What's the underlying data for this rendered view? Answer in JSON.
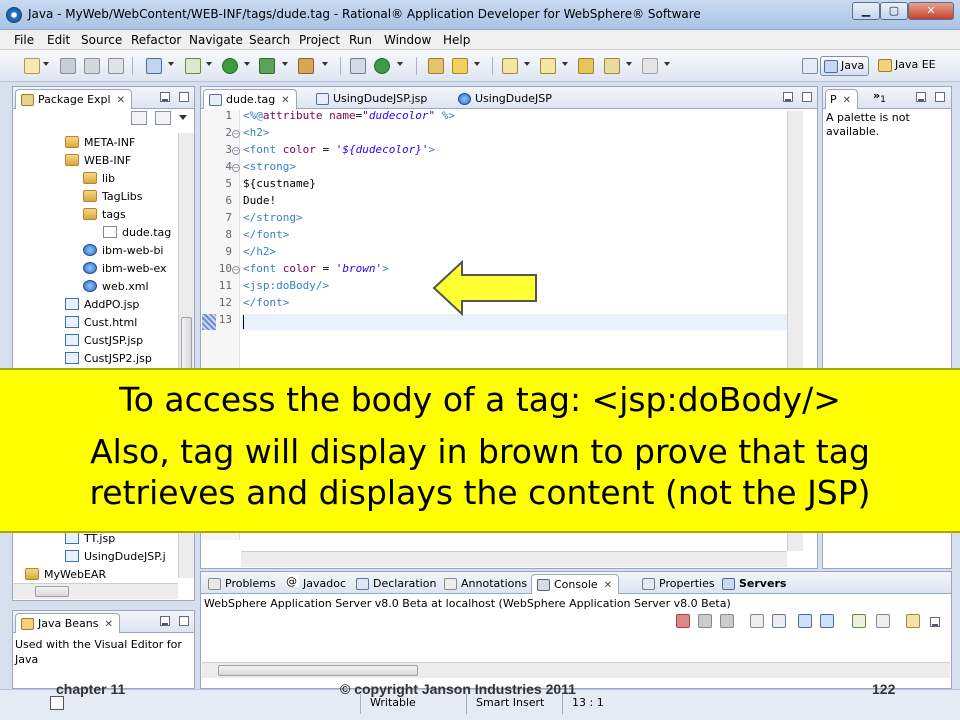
{
  "window": {
    "title": "Java - MyWeb/WebContent/WEB-INF/tags/dude.tag - Rational® Application Developer for WebSphere® Software"
  },
  "menu": [
    "File",
    "Edit",
    "Source",
    "Refactor",
    "Navigate",
    "Search",
    "Project",
    "Run",
    "Window",
    "Help"
  ],
  "perspectives": {
    "java": "Java",
    "java_ee": "Java EE"
  },
  "package_explorer": {
    "tab_label": "Package Expl",
    "items": [
      {
        "label": "META-INF",
        "icon": "folder-icon"
      },
      {
        "label": "WEB-INF",
        "icon": "folder-icon"
      },
      {
        "label": "lib",
        "icon": "folder-icon"
      },
      {
        "label": "TagLibs",
        "icon": "folder-icon"
      },
      {
        "label": "tags",
        "icon": "folder-icon"
      },
      {
        "label": "dude.tag",
        "icon": "file-icon"
      },
      {
        "label": "ibm-web-bi",
        "icon": "web-icon"
      },
      {
        "label": "ibm-web-ex",
        "icon": "web-icon"
      },
      {
        "label": "web.xml",
        "icon": "web-icon"
      },
      {
        "label": "AddPO.jsp",
        "icon": "jsp-icon"
      },
      {
        "label": "Cust.html",
        "icon": "jsp-icon"
      },
      {
        "label": "CustJSP.jsp",
        "icon": "jsp-icon"
      },
      {
        "label": "CustJSP2.jsp",
        "icon": "jsp-icon"
      }
    ],
    "bottom_items": [
      {
        "label": "TT.jsp",
        "icon": "jsp-icon"
      },
      {
        "label": "UsingDudeJSP.j",
        "icon": "jsp-icon"
      },
      {
        "label": "MyWebEAR",
        "icon": "project-icon"
      }
    ]
  },
  "editor": {
    "tabs": [
      {
        "label": "dude.tag"
      },
      {
        "label": "UsingDudeJSP.jsp"
      },
      {
        "label": "UsingDudeJSP"
      }
    ],
    "lines": [
      {
        "n": "1",
        "parts": [
          [
            "tag",
            "<%@"
          ],
          [
            "attr",
            "attribute "
          ],
          [
            "attr",
            "name"
          ],
          [
            "plain",
            "="
          ],
          [
            "str",
            "\"dudecolor\""
          ],
          [
            "tag",
            " %>"
          ]
        ]
      },
      {
        "n": "2",
        "parts": [
          [
            "tag",
            "<h2>"
          ]
        ]
      },
      {
        "n": "3",
        "parts": [
          [
            "tag",
            "<font "
          ],
          [
            "attr",
            "color"
          ],
          [
            "plain",
            " = "
          ],
          [
            "str",
            "'${dudecolor}'"
          ],
          [
            "tag",
            ">"
          ]
        ]
      },
      {
        "n": "4",
        "parts": [
          [
            "tag",
            "<strong>"
          ]
        ]
      },
      {
        "n": "5",
        "parts": [
          [
            "plain",
            "${custname}"
          ]
        ]
      },
      {
        "n": "6",
        "parts": [
          [
            "plain",
            "Dude!"
          ]
        ]
      },
      {
        "n": "7",
        "parts": [
          [
            "tag",
            "</strong>"
          ]
        ]
      },
      {
        "n": "8",
        "parts": [
          [
            "tag",
            "</font>"
          ]
        ]
      },
      {
        "n": "9",
        "parts": [
          [
            "tag",
            "</h2>"
          ]
        ]
      },
      {
        "n": "10",
        "parts": [
          [
            "tag",
            "<font "
          ],
          [
            "attr",
            "color"
          ],
          [
            "plain",
            " = "
          ],
          [
            "str",
            "'brown'"
          ],
          [
            "tag",
            ">"
          ]
        ]
      },
      {
        "n": "11",
        "parts": [
          [
            "tag",
            "<jsp:doBody/>"
          ]
        ]
      },
      {
        "n": "12",
        "parts": [
          [
            "tag",
            "</font>"
          ]
        ]
      },
      {
        "n": "13",
        "parts": []
      }
    ]
  },
  "palette": {
    "tab_label": "P",
    "overflow": "1",
    "message": "A palette is not available."
  },
  "bottom_panel": {
    "tabs": [
      "Problems",
      "Javadoc",
      "Declaration",
      "Annotations",
      "Console",
      "Properties",
      "Servers"
    ],
    "console_text": "WebSphere Application Server v8.0 Beta at localhost (WebSphere Application Server v8.0 Beta)"
  },
  "java_beans": {
    "tab_label": "Java Beans",
    "text": "Used with the Visual Editor for Java"
  },
  "status": {
    "writable": "Writable",
    "insert": "Smart Insert",
    "position": "13 : 1"
  },
  "slide": {
    "line1": "To access the body of a tag: <jsp:doBody/>",
    "line2": "Also, tag will display in brown to prove that tag",
    "line3": "retrieves and displays the content (not the JSP)",
    "footer_left": "chapter 11",
    "footer_center": "© copyright Janson Industries 2011",
    "page_number": "122"
  },
  "colors": {
    "banner": "#ffff00",
    "arrow_fill": "#ffff33",
    "tag": "#3a7fc0",
    "attr": "#7f0055",
    "string": "#2a00ff"
  }
}
